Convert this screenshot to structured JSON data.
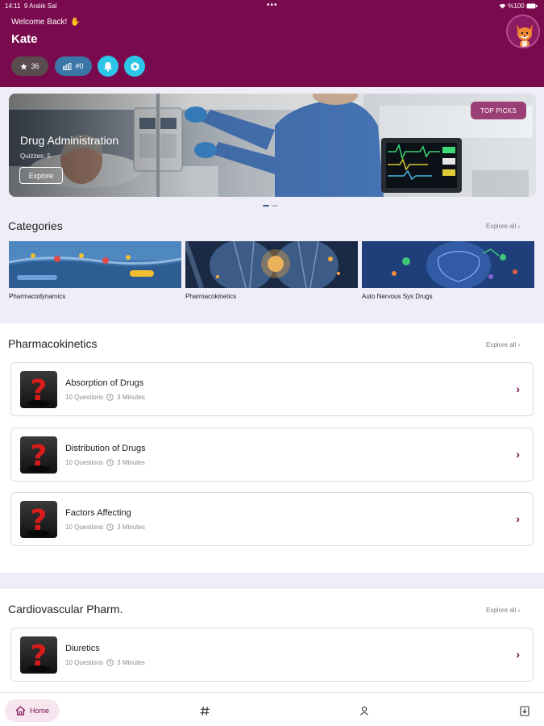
{
  "status_bar": {
    "time": "14:11",
    "date": "9 Aralık Sal",
    "battery": "%100",
    "dots": "•••"
  },
  "header": {
    "welcome": "Welcome Back!",
    "wave": "✋",
    "user_name": "Kate",
    "stars_count": "36",
    "rank_value": "#0"
  },
  "hero": {
    "title": "Drug Administration",
    "quizzes": "Quizzes: 5",
    "explore_label": "Explore",
    "badge": "TOP PICKS",
    "slides": 2,
    "active_slide": 1
  },
  "categories": {
    "title": "Categories",
    "explore_all": "Explore all ›",
    "items": [
      {
        "label": "Pharmacodynamics"
      },
      {
        "label": "Pharmacokinetics"
      },
      {
        "label": "Auto Nervous Sys Drugs"
      }
    ]
  },
  "pharmacokinetics": {
    "title": "Pharmacokinetics",
    "explore_all": "Explore all ›",
    "items": [
      {
        "name": "Absorption of Drugs",
        "questions": "10 Questions",
        "duration": "3 Minutes"
      },
      {
        "name": "Distribution of Drugs",
        "questions": "10 Questions",
        "duration": "3 Minutes"
      },
      {
        "name": "Factors Affecting",
        "questions": "10 Questions",
        "duration": "3 Minutes"
      }
    ]
  },
  "cardiovascular": {
    "title": "Cardiovascular Pharm.",
    "explore_all": "Explore all ›",
    "items": [
      {
        "name": "Diuretics",
        "questions": "10 Questions",
        "duration": "3 Minutes"
      }
    ]
  },
  "bottom_nav": {
    "home_label": "Home"
  },
  "colors": {
    "brand": "#7a0a4e",
    "accent": "#2cc6e8",
    "background": "#efeef8"
  },
  "icons": [
    "star-icon",
    "chart-icon",
    "bell-icon",
    "hexagon-icon",
    "clock-icon",
    "chevron-right-icon",
    "home-icon",
    "hash-icon",
    "user-icon",
    "download-icon"
  ]
}
